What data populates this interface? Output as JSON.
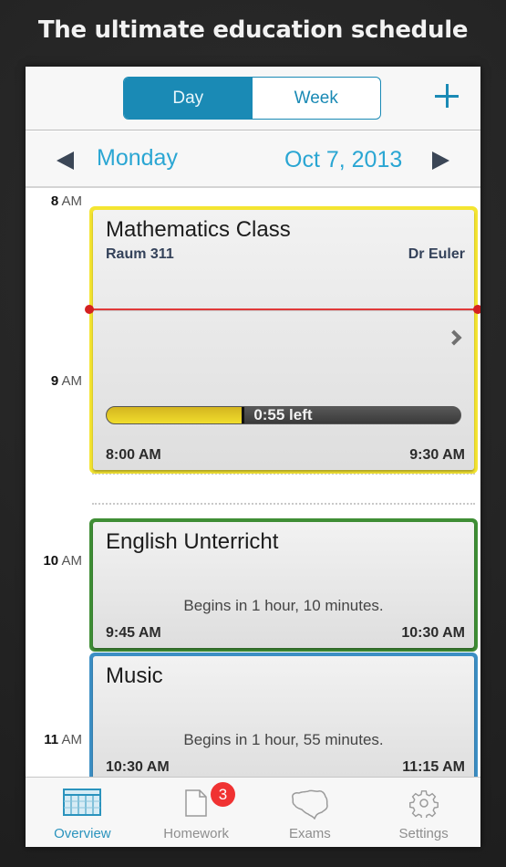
{
  "headline": "The ultimate education schedule",
  "navbar": {
    "segments": [
      {
        "label": "Day",
        "active": true
      },
      {
        "label": "Week",
        "active": false
      }
    ],
    "add_icon": "plus-icon"
  },
  "datebar": {
    "prev_icon": "triangle-left-icon",
    "day": "Monday",
    "date": "Oct 7, 2013",
    "next_icon": "triangle-right-icon"
  },
  "timeline": {
    "hours": [
      {
        "num": "8",
        "suffix": "AM"
      },
      {
        "num": "9",
        "suffix": "AM"
      },
      {
        "num": "10",
        "suffix": "AM"
      },
      {
        "num": "11",
        "suffix": "AM"
      }
    ],
    "events": [
      {
        "title": "Mathematics Class",
        "room": "Raum 311",
        "teacher": "Dr Euler",
        "start": "8:00 AM",
        "end": "9:30 AM",
        "color": "#f4e531",
        "progress_fraction": 0.39,
        "progress_text": "0:55 left"
      },
      {
        "title": "English Unterricht",
        "status": "Begins in 1 hour, 10 minutes.",
        "start": "9:45 AM",
        "end": "10:30 AM",
        "color": "#3f8e35"
      },
      {
        "title": "Music",
        "status": "Begins in 1 hour, 55 minutes.",
        "start": "10:30 AM",
        "end": "11:15 AM",
        "color": "#3c8fc4"
      }
    ],
    "now_line_color": "#e03a3a"
  },
  "tabbar": {
    "tabs": [
      {
        "label": "Overview",
        "icon": "calendar-grid-icon",
        "active": true
      },
      {
        "label": "Homework",
        "icon": "document-icon",
        "badge": "3"
      },
      {
        "label": "Exams",
        "icon": "brain-icon"
      },
      {
        "label": "Settings",
        "icon": "gear-icon"
      }
    ]
  },
  "colors": {
    "accent": "#1a8ab5",
    "link": "#2aa6d3",
    "badge": "#f03232"
  }
}
